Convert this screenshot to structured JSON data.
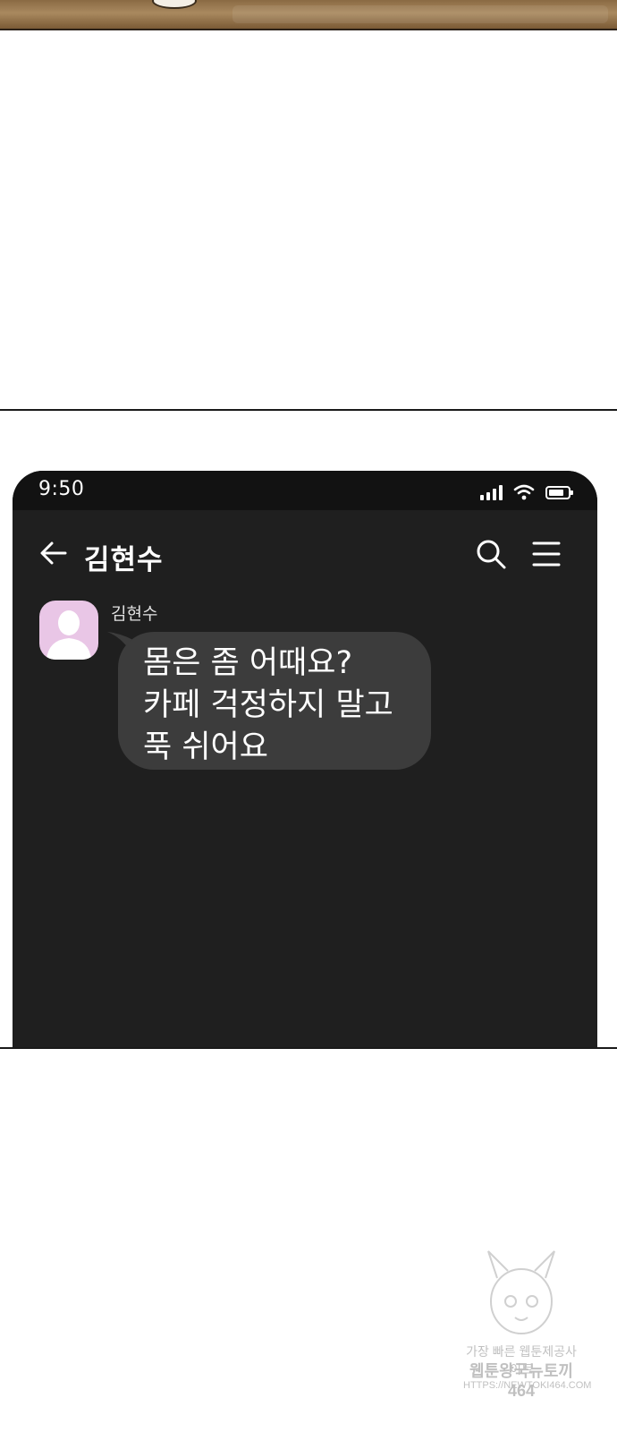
{
  "status_bar": {
    "time": "9:50"
  },
  "header": {
    "title": "김현수"
  },
  "message": {
    "sender": "김현수",
    "lines": [
      "몸은 좀 어때요?",
      "카페 걱정하지 말고",
      "푹 쉬어요"
    ]
  },
  "watermark": {
    "line1": "가장 빠른 웹툰제공사이트",
    "line2": "웹툰왕국뉴토끼464",
    "line3": "HTTPS://NEWTOKI464.COM"
  },
  "colors": {
    "phone_bg": "#1f1f1f",
    "status_bg": "#121212",
    "bubble_bg": "#3c3c3c",
    "avatar_bg": "#e9c6e6",
    "text": "#ffffff"
  },
  "icons": [
    "back-arrow-icon",
    "search-icon",
    "menu-icon",
    "signal-icon",
    "wifi-icon",
    "battery-icon",
    "profile-silhouette-icon"
  ]
}
